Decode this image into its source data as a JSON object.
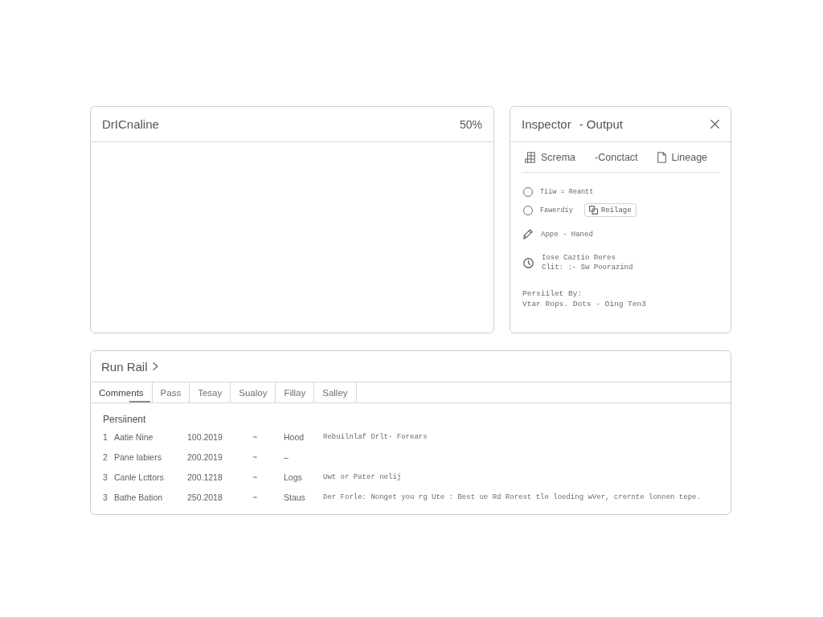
{
  "canvas": {
    "title": "DrICnaline",
    "zoom": "50%"
  },
  "inspector": {
    "title": "Inspector",
    "subtitle": "- Output",
    "tabs": [
      {
        "label": "Screma"
      },
      {
        "label": "-Conctact"
      },
      {
        "label": "Lineage"
      }
    ],
    "options": [
      {
        "label": "Tiiw = Reantt",
        "checked": false
      },
      {
        "label": "Fawerdiy",
        "checked": false,
        "action": "Reilage"
      }
    ],
    "details": [
      {
        "lines": [
          "Appe - Haned"
        ]
      },
      {
        "lines": [
          "Iose Caztio Reres",
          "Clit: :- Sw Poorazind"
        ]
      }
    ],
    "credit": {
      "label": "Persiilet By:",
      "value": "Vtar Rops. Dots - Oing Ten3"
    }
  },
  "run_rail": {
    "title": "Run Rail",
    "tabs": [
      {
        "label": "Comments",
        "selected": true
      },
      {
        "label": "Pass",
        "selected": false
      },
      {
        "label": "Tesay",
        "selected": false
      },
      {
        "label": "Sualoy",
        "selected": false
      },
      {
        "label": "Fillay",
        "selected": false
      },
      {
        "label": "Salley",
        "selected": false
      }
    ],
    "section": "Persiinent",
    "rows": [
      {
        "index": "1",
        "name": "Aatie Nine",
        "date": "100.2019",
        "trend": "~",
        "type": "Hood",
        "note": "Rebuilnlaf Drlt- Forears"
      },
      {
        "index": "2",
        "name": "Pane Iabiers",
        "date": "200.2019",
        "trend": "~",
        "type": "–"
      },
      {
        "index": "3",
        "name": "Canle Lcttors",
        "date": "200.1218",
        "trend": "~",
        "type": "Logs",
        "note": "Uwt or Pater nelij"
      },
      {
        "index": "3",
        "name": "Bathe Bation",
        "date": "250.2018",
        "trend": "~",
        "type": "Staus",
        "note": "Der Forle: Nonget you rg Ute : Best ue Rd Rorest tle loeding wVer, crernte lonnen tepe."
      }
    ]
  }
}
